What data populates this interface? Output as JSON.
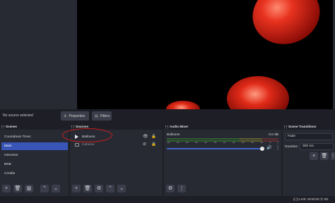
{
  "context_bar": {
    "selection_label": "No source selected",
    "properties_label": "Properties",
    "filters_label": "Filters"
  },
  "scenes": {
    "title": "Scenes",
    "items": [
      "Countdown Timer",
      "Main",
      "Interview",
      "BRB",
      "Credits"
    ],
    "selected_index": 1
  },
  "sources": {
    "title": "Sources",
    "items": [
      {
        "label": "Balloons",
        "icon": "play-icon",
        "visible": true,
        "locked": false
      },
      {
        "label": "Camera",
        "icon": "camera-icon",
        "visible": false,
        "locked": true
      }
    ]
  },
  "audio_mixer": {
    "title": "Audio Mixer",
    "channel": "Balloons",
    "db": "0.0 dB",
    "ticks": [
      "-60",
      "-55",
      "-50",
      "-45",
      "-40",
      "-35",
      "-30",
      "-25",
      "-20",
      "-15",
      "-10",
      "-5",
      "0"
    ],
    "volume_fraction": 0.95
  },
  "transitions": {
    "title": "Scene Transitions",
    "type": "Fade",
    "duration_label": "Duration",
    "duration_value": "300 ms"
  },
  "status": {
    "live": "LIVE: 00:00:00",
    "rec_prefix": "RE"
  },
  "colors": {
    "accent": "#3955b8",
    "balloon": "#e0241b",
    "highlight_circle": "#d41f1f"
  }
}
